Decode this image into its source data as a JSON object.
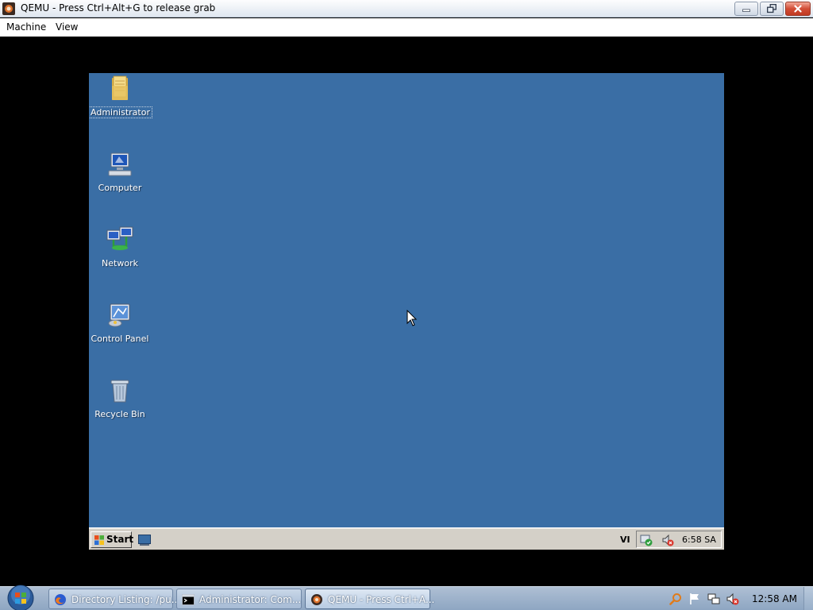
{
  "window": {
    "title": "QEMU - Press Ctrl+Alt+G to release grab",
    "icon": "qemu-icon",
    "controls": [
      "minimize-icon",
      "restore-icon",
      "close-icon"
    ]
  },
  "menubar": {
    "items": [
      "Machine",
      "View"
    ]
  },
  "guest": {
    "background_color": "#3a6ea5",
    "desktop_icons": [
      {
        "label": "Administrator",
        "icon": "folder-icon",
        "selected": true
      },
      {
        "label": "Computer",
        "icon": "computer-icon"
      },
      {
        "label": "Network",
        "icon": "network-icon"
      },
      {
        "label": "Control Panel",
        "icon": "control-panel-icon"
      },
      {
        "label": "Recycle Bin",
        "icon": "recycle-bin-icon"
      }
    ],
    "taskbar": {
      "start_label": "Start",
      "language": "VI",
      "clock": "6:58 SA"
    }
  },
  "host_taskbar": {
    "tasks": [
      {
        "label": "Directory Listing: /pu...",
        "icon": "firefox-icon"
      },
      {
        "label": "Administrator:  Com...",
        "icon": "cmd-icon"
      },
      {
        "label": "QEMU - Press Ctrl+A...",
        "icon": "qemu-icon",
        "active": true
      }
    ],
    "clock": "12:58 AM"
  }
}
